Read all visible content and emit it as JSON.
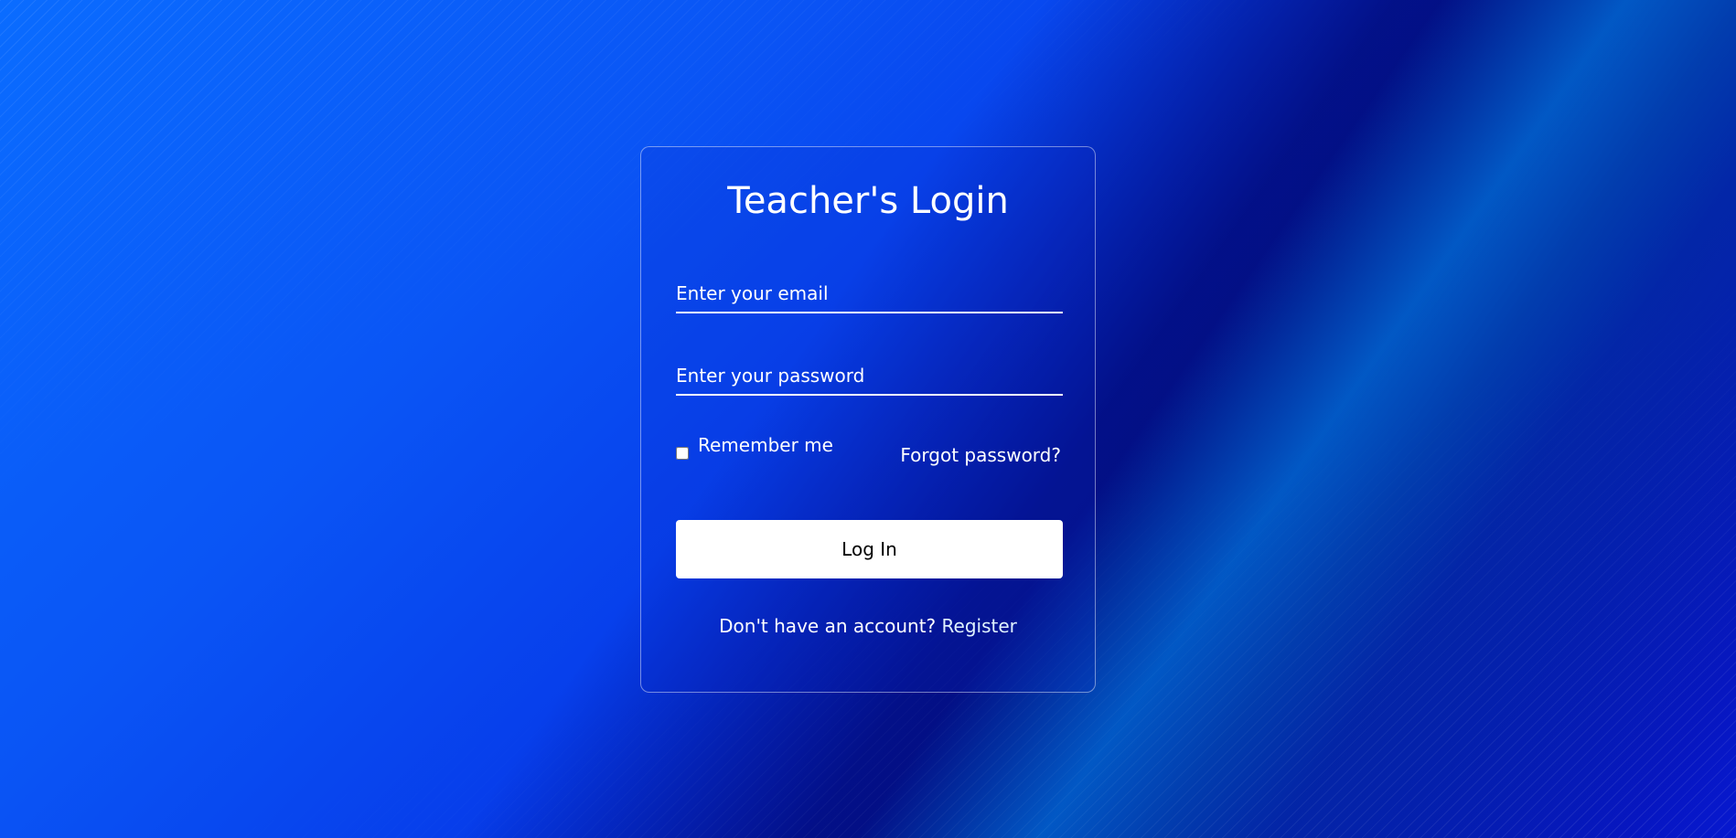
{
  "login": {
    "title": "Teacher's Login",
    "email_placeholder": "Enter your email",
    "password_placeholder": "Enter your password",
    "remember_label": "Remember me",
    "remember_checked": false,
    "forgot_label": "Forgot password?",
    "login_button_label": "Log In",
    "register_prompt": "Don't have an account?",
    "register_link": "Register"
  },
  "colors": {
    "background_primary": "#0a55f5",
    "background_dark": "#020a78",
    "card_border": "#ffffff",
    "button_bg": "#ffffff",
    "button_text": "#000000"
  }
}
